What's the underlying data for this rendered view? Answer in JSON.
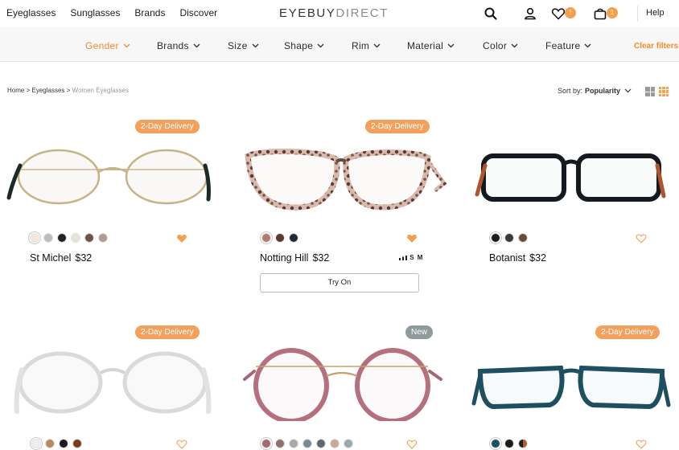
{
  "topnav": {
    "links": [
      "Eyeglasses",
      "Sunglasses",
      "Brands",
      "Discover"
    ],
    "logo_bold": "EYEBUY",
    "logo_light": "DIRECT",
    "wishlist_badge": "!",
    "cart_badge": "1",
    "help_label": "Help",
    "icons": [
      "search-icon",
      "user-icon",
      "heart-icon",
      "cart-icon"
    ]
  },
  "filters": {
    "items": [
      "Gender",
      "Brands",
      "Size",
      "Shape",
      "Rim",
      "Material",
      "Color",
      "Feature"
    ],
    "active": "Gender",
    "clear_label": "Clear filters"
  },
  "breadcrumb": {
    "home": "Home",
    "sep": ">",
    "level1": "Eyeglasses",
    "current": "Women Eyeglasses"
  },
  "sort": {
    "label": "Sort by:",
    "value": "Popularity"
  },
  "colors": {
    "accent": "#f08c2e",
    "badge_orange": "#f2a05c",
    "badge_grey": "#8e9a9b"
  },
  "products": [
    {
      "tag": "2-Day Delivery",
      "tag_type": "orange",
      "name": "St Michel",
      "price": "$32",
      "frame_style": "gold-round",
      "swatches": [
        "#f5e8d4",
        "#bdbdbd",
        "#222222",
        "#e6e1da",
        "#6b5445",
        "#b09a92"
      ],
      "favorited": true,
      "size_label": "",
      "try_on": ""
    },
    {
      "tag": "2-Day Delivery",
      "tag_type": "orange",
      "name": "Notting Hill",
      "price": "$32",
      "frame_style": "tortoise-pink",
      "swatches": [
        "#b07c70",
        "#5a3b30",
        "#1f2b35"
      ],
      "favorited": true,
      "size_label": "S M",
      "try_on": "Try On"
    },
    {
      "tag": "",
      "tag_type": "",
      "name": "Botanist",
      "price": "$32",
      "frame_style": "black-rect",
      "swatches": [
        "#1d1d1d",
        "#3a3a3a",
        "#6c4b3a"
      ],
      "favorited": false,
      "size_label": "",
      "try_on": ""
    },
    {
      "tag": "2-Day Delivery",
      "tag_type": "orange",
      "name": "",
      "price": "",
      "frame_style": "clear-round",
      "swatches": [
        "#eeeeee",
        "#b98a5b",
        "#1c1c1c",
        "#7a3e1c"
      ],
      "favorited": false,
      "size_label": "",
      "try_on": ""
    },
    {
      "tag": "New",
      "tag_type": "grey",
      "name": "",
      "price": "",
      "frame_style": "rose-round",
      "swatches": [
        "#a36a73",
        "#8f6f6f",
        "#a9a9a9",
        "#7b8b94",
        "#5d6870",
        "#c9a894",
        "#9aa9b0"
      ],
      "favorited": false,
      "size_label": "",
      "try_on": ""
    },
    {
      "tag": "2-Day Delivery",
      "tag_type": "orange",
      "name": "",
      "price": "",
      "frame_style": "teal-rect",
      "swatches": [
        "#1f4e5f",
        "#1a1a1a",
        "#b05c2a"
      ],
      "favorited": false,
      "size_label": "",
      "try_on": ""
    }
  ]
}
